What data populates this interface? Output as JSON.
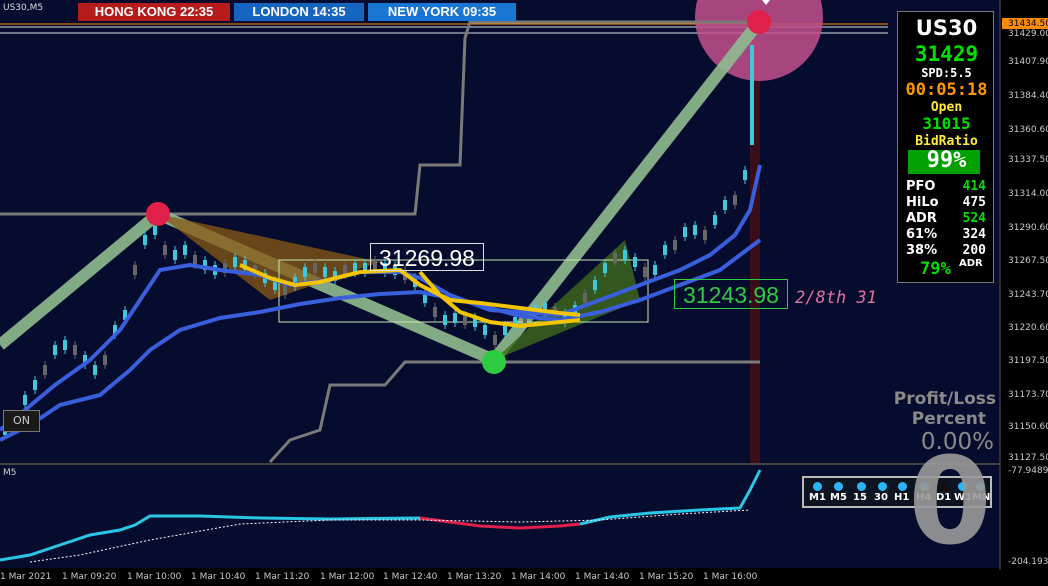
{
  "symbol_tf": "US30,M5",
  "sub_window_label": "M5",
  "clocks": [
    {
      "label": "HONG KONG 22:35",
      "color": "#b71c1c"
    },
    {
      "label": "LONDON  14:35",
      "color": "#1565c0"
    },
    {
      "label": "NEW YORK  09:35",
      "color": "#1976d2"
    }
  ],
  "price_axis": [
    "31434.50",
    "31429.00",
    "31407.90",
    "31384.40",
    "31360.60",
    "31337.50",
    "31314.00",
    "31290.60",
    "31267.50",
    "31243.70",
    "31220.60",
    "31197.50",
    "31173.70",
    "31150.60",
    "31127.50"
  ],
  "sub_axis": [
    "-77.9489",
    "-204.1937"
  ],
  "time_axis": [
    "1 Mar 2021",
    "1 Mar 09:20",
    "1 Mar 10:00",
    "1 Mar 10:40",
    "1 Mar 11:20",
    "1 Mar 12:00",
    "1 Mar 12:40",
    "1 Mar 13:20",
    "1 Mar 14:00",
    "1 Mar 14:40",
    "1 Mar 15:20",
    "1 Mar 16:00"
  ],
  "box_labels": {
    "upper": "31269.98",
    "lower": "31243.98",
    "fraction": "2/8th  31"
  },
  "on_button": "ON",
  "info": {
    "symbol": "US30",
    "price": "31429",
    "spread": "SPD:5.5",
    "timer": "00:05:18",
    "open_label": "Open",
    "open_value": "31015",
    "bid_ratio_label": "BidRatio",
    "bid_ratio_value": "99%",
    "rows": [
      {
        "k": "PFO",
        "v": "414",
        "color": "#00e000"
      },
      {
        "k": "HiLo",
        "v": "475",
        "color": "#ffffff"
      },
      {
        "k": "ADR",
        "v": "524",
        "color": "#00e000"
      },
      {
        "k": "61%",
        "v": "324",
        "color": "#ffffff"
      },
      {
        "k": "38%",
        "v": "200",
        "color": "#ffffff"
      }
    ],
    "adr_percent": "79%",
    "adr_label": "ADR"
  },
  "profit_loss": {
    "line1": "Profit/Loss",
    "line2": "Percent",
    "value": "0.00%",
    "big_digit": "0"
  },
  "timeframes": [
    "M1",
    "M5",
    "15",
    "30",
    "H1",
    "H4",
    "D1",
    "W1",
    "MN"
  ],
  "colors": {
    "bg": "#050c2e",
    "candle_up": "#3ec8dc",
    "candle_dn": "#666666",
    "ema_fast": "#3a5fdc",
    "yellow": "#f5c400",
    "green_band": "#8fbc8f",
    "pink": "#e070a0"
  }
}
